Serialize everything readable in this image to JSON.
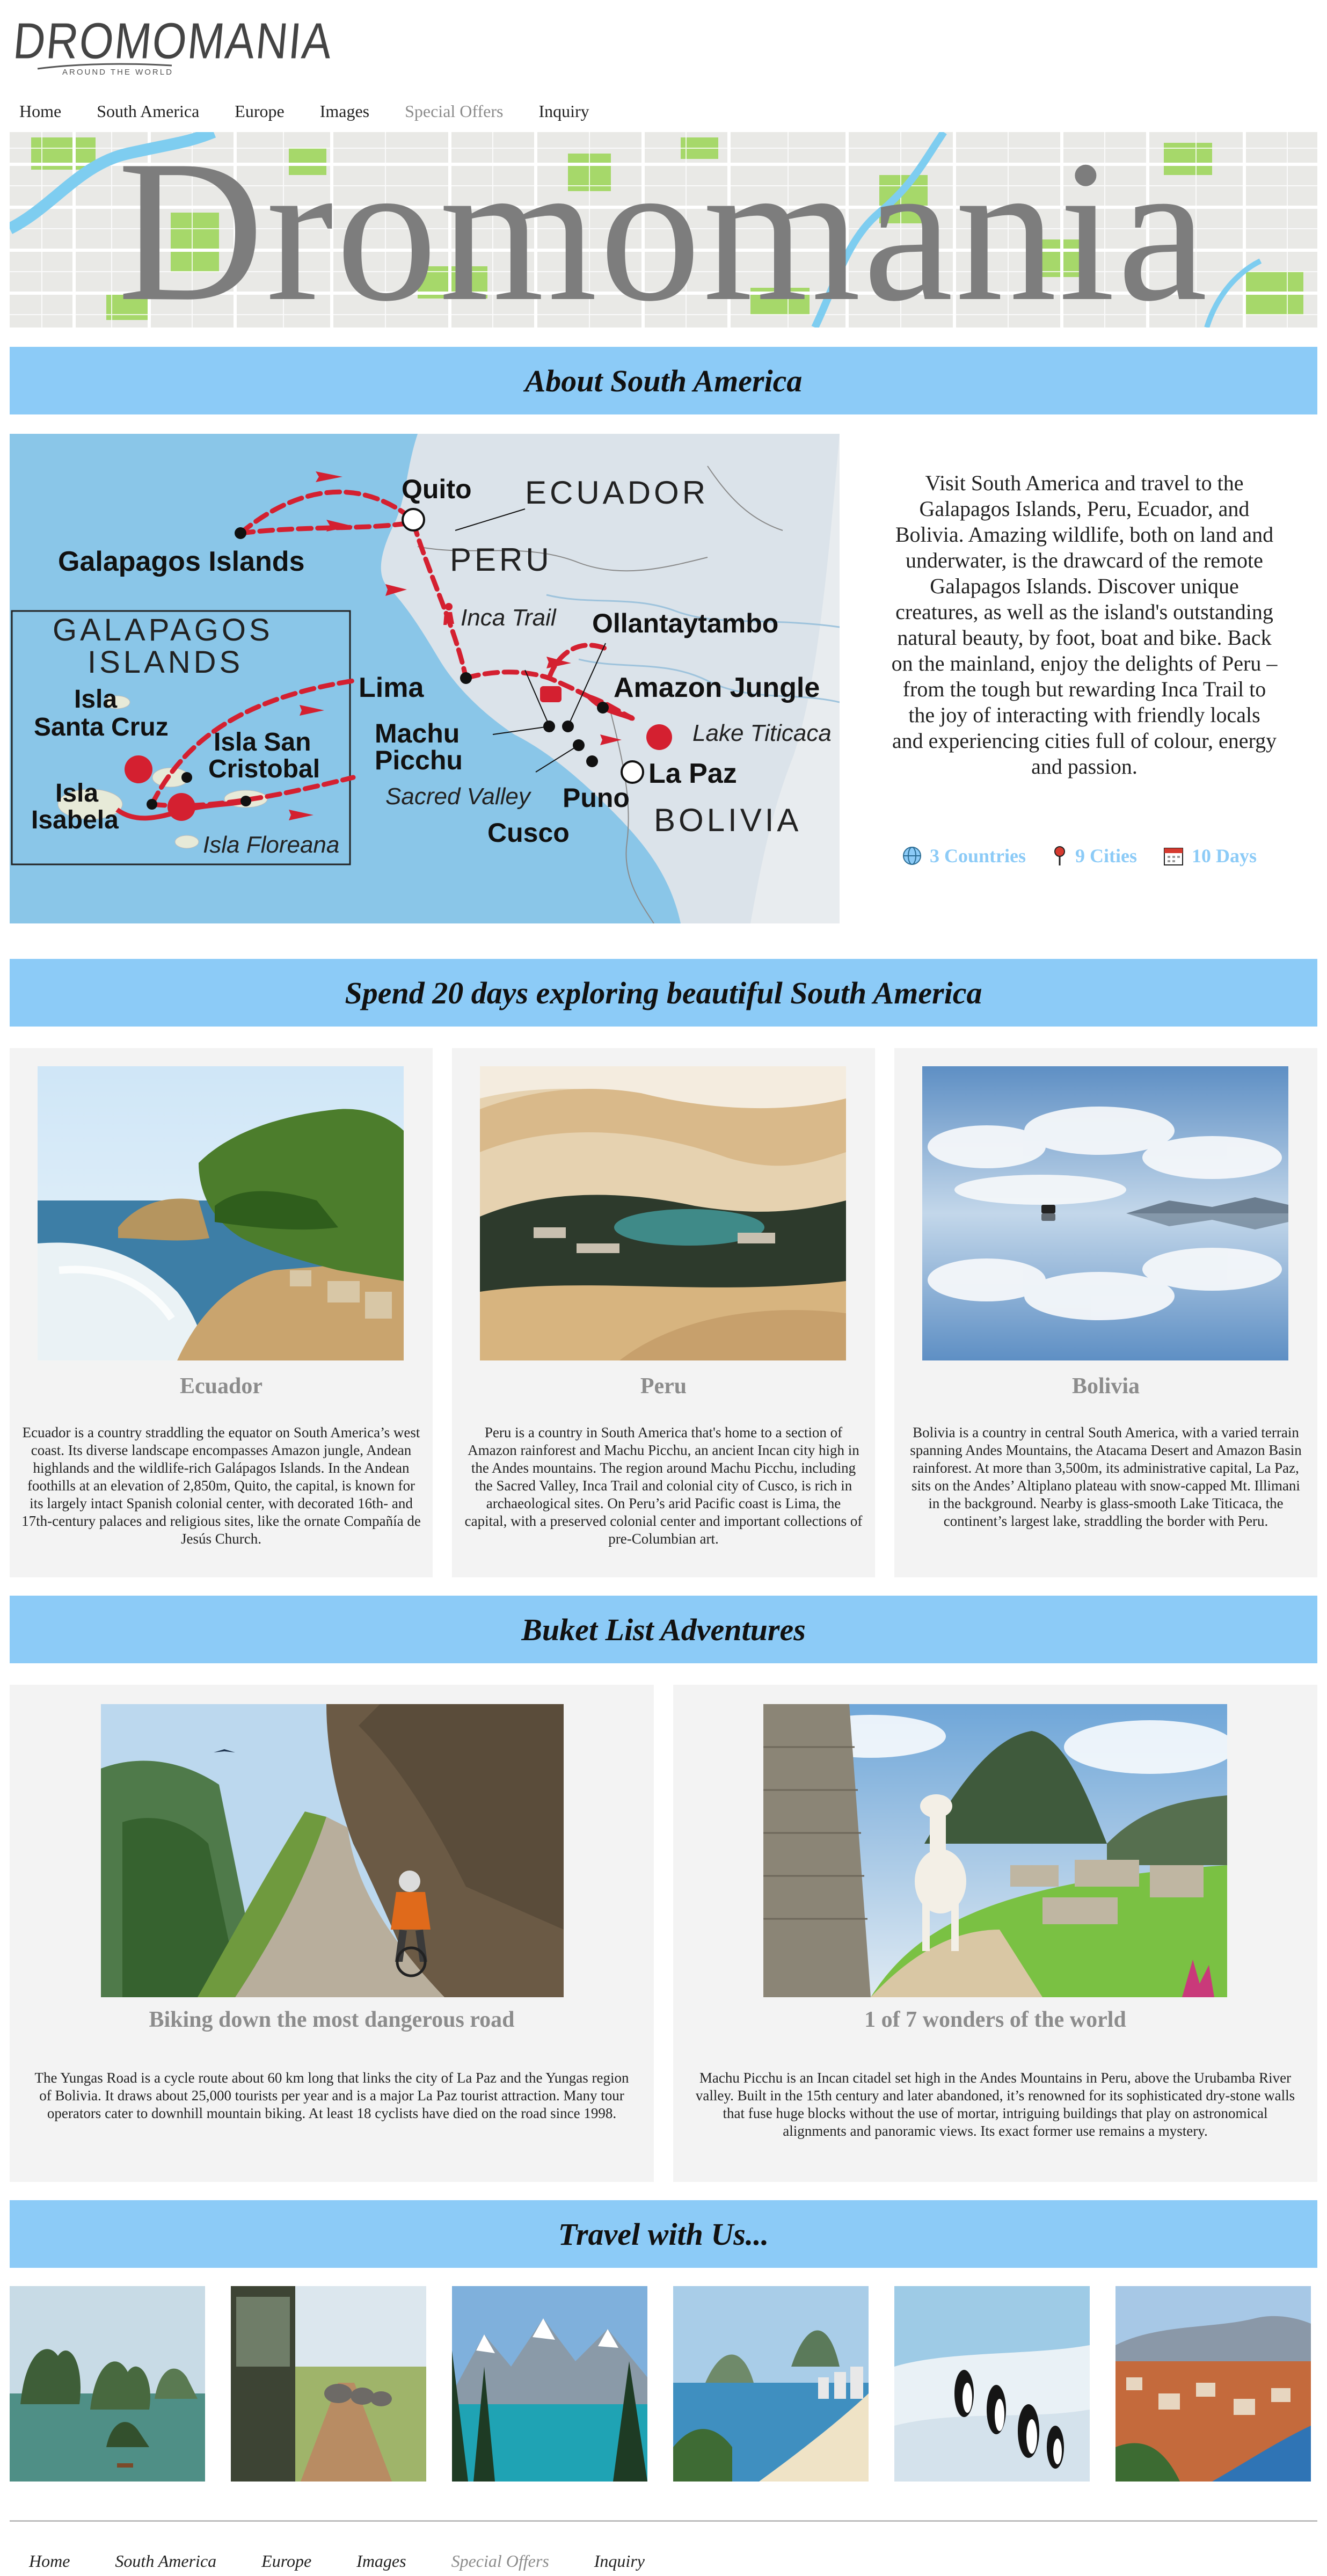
{
  "logo": {
    "name": "DROMOMANIA",
    "tagline": "AROUND THE WORLD"
  },
  "nav": [
    {
      "label": "Home",
      "muted": false
    },
    {
      "label": "South America",
      "muted": false
    },
    {
      "label": "Europe",
      "muted": false
    },
    {
      "label": "Images",
      "muted": false
    },
    {
      "label": "Special Offers",
      "muted": true
    },
    {
      "label": "Inquiry",
      "muted": false
    }
  ],
  "hero": {
    "title": "Dromomania"
  },
  "about": {
    "heading": "About South America",
    "text": "Visit South America and travel to the Galapagos Islands, Peru, Ecuador, and Bolivia. Amazing wildlife, both on land and underwater, is the drawcard of the remote Galapagos Islands. Discover unique creatures, as well as the island's outstanding natural beauty, by foot, boat and bike. Back on the mainland, enjoy the delights of Peru – from the tough but rewarding Inca Trail to the joy of interacting with friendly locals and experiencing cities full of colour, energy and passion.",
    "stats": [
      {
        "icon": "globe-icon",
        "label": "3 Countries"
      },
      {
        "icon": "map-pin-icon",
        "label": "9 Cities"
      },
      {
        "icon": "calendar-icon",
        "label": "10 Days"
      }
    ]
  },
  "route_map": {
    "countries": [
      "ECUADOR",
      "PERU",
      "BOLIVIA"
    ],
    "inset_title_1": "GALAPAGOS",
    "inset_title_2": "ISLANDS",
    "places": {
      "quito": "Quito",
      "galapagos": "Galapagos Islands",
      "inca_trail": "Inca Trail",
      "ollantaytambo": "Ollantaytambo",
      "amazon": "Amazon Jungle",
      "lima": "Lima",
      "machu_1": "Machu",
      "machu_2": "Picchu",
      "lake": "Lake Titicaca",
      "sacred": "Sacred Valley",
      "la_paz": "La Paz",
      "puno": "Puno",
      "cusco": "Cusco",
      "santa_cruz_1": "Isla",
      "santa_cruz_2": "Santa Cruz",
      "san_cristobal_1": "Isla San",
      "san_cristobal_2": "Cristobal",
      "isabela_1": "Isla",
      "isabela_2": "Isabela",
      "floreana": "Isla Floreana"
    }
  },
  "explore": {
    "heading": "Spend 20 days exploring beautiful South America",
    "cards": [
      {
        "title": "Ecuador",
        "image": "ecuador-coast-photo",
        "text": "Ecuador is a country straddling the equator on South America’s west coast. Its diverse landscape encompasses Amazon jungle, Andean highlands and the wildlife-rich Galápagos Islands. In the Andean foothills at an elevation of 2,850m, Quito, the capital, is known for its largely intact Spanish colonial center, with decorated 16th- and 17th-century palaces and religious sites, like the ornate Compañía de Jesús Church."
      },
      {
        "title": "Peru",
        "image": "peru-desert-oasis-photo",
        "text": "Peru is a country in South America that's home to a section of Amazon rainforest and Machu Picchu, an ancient Incan city high in the Andes mountains. The region around Machu Picchu, including the Sacred Valley, Inca Trail and colonial city of Cusco, is rich in archaeological sites. On Peru’s arid Pacific coast is Lima, the capital, with a preserved colonial center and important collections of pre-Columbian art."
      },
      {
        "title": "Bolivia",
        "image": "bolivia-salt-flat-photo",
        "text": "Bolivia is a country in central South America, with a varied terrain spanning Andes Mountains, the Atacama Desert and Amazon Basin rainforest. At more than 3,500m, its administrative capital, La Paz, sits on the Andes’ Altiplano plateau with snow-capped Mt. Illimani in the background. Nearby is glass-smooth Lake Titicaca, the continent’s largest lake, straddling the border with Peru."
      }
    ]
  },
  "bucket": {
    "heading": "Buket List Adventures",
    "cards": [
      {
        "title": "Biking down the most dangerous road",
        "image": "yungas-road-biking-photo",
        "text": "The Yungas Road is a cycle route about 60 km long that links the city of La Paz and the Yungas region of Bolivia. It draws about 25,000 tourists per year and is a major La Paz tourist attraction. Many tour operators cater to downhill mountain biking. At least 18 cyclists have died on the road since 1998."
      },
      {
        "title": "1 of 7 wonders of the world",
        "image": "machu-picchu-llama-photo",
        "text": "Machu Picchu is an Incan citadel set high in the Andes Mountains in Peru, above the Urubamba River valley. Built in the 15th century and later abandoned, it’s renowned for its sophisticated dry-stone walls that fuse huge blocks without the use of mortar, intriguing buildings that play on astronomical alignments and panoramic views. Its exact former use remains a mystery."
      }
    ]
  },
  "travel": {
    "heading": "Travel with Us...",
    "thumbs": [
      "karst-bay-photo",
      "elephants-safari-photo",
      "mountain-lake-photo",
      "beach-city-photo",
      "penguins-photo",
      "coastal-town-photo"
    ]
  },
  "footer_nav": [
    {
      "label": "Home",
      "muted": false
    },
    {
      "label": "South America",
      "muted": false
    },
    {
      "label": "Europe",
      "muted": false
    },
    {
      "label": "Images",
      "muted": false
    },
    {
      "label": "Special Offers",
      "muted": true
    },
    {
      "label": "Inquiry",
      "muted": false
    }
  ],
  "colors": {
    "banner": "#8ccbf7",
    "muted_text": "#8c8c8c",
    "card_bg": "#f3f3f3",
    "route_red": "#d42030"
  }
}
